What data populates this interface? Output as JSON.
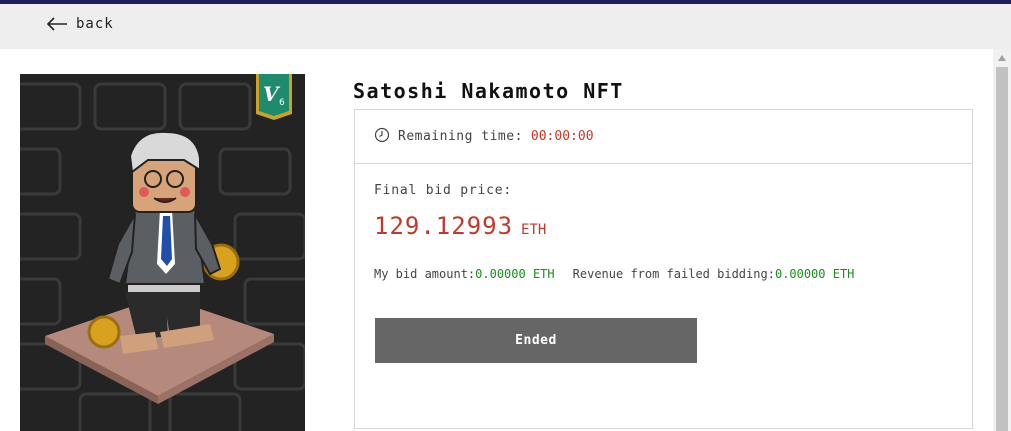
{
  "nav": {
    "back_label": "back"
  },
  "nft": {
    "title": "Satoshi Nakamoto NFT",
    "badge": "V6"
  },
  "auction": {
    "remaining_label": "Remaining time:",
    "remaining_value": "00:00:00",
    "final_bid_label": "Final bid price:",
    "final_bid_value": "129.12993",
    "final_bid_unit": "ETH",
    "my_bid_label": "My bid amount:",
    "my_bid_value": "0.00000 ETH",
    "revenue_label": "Revenue from failed bidding:",
    "revenue_value": "0.00000 ETH",
    "status_button": "Ended"
  },
  "colors": {
    "accent_red": "#c0392b",
    "value_green": "#1a8f1a",
    "button_gray": "#666666",
    "badge_green": "#1e8a6e",
    "top_strip": "#1f1d5c"
  }
}
